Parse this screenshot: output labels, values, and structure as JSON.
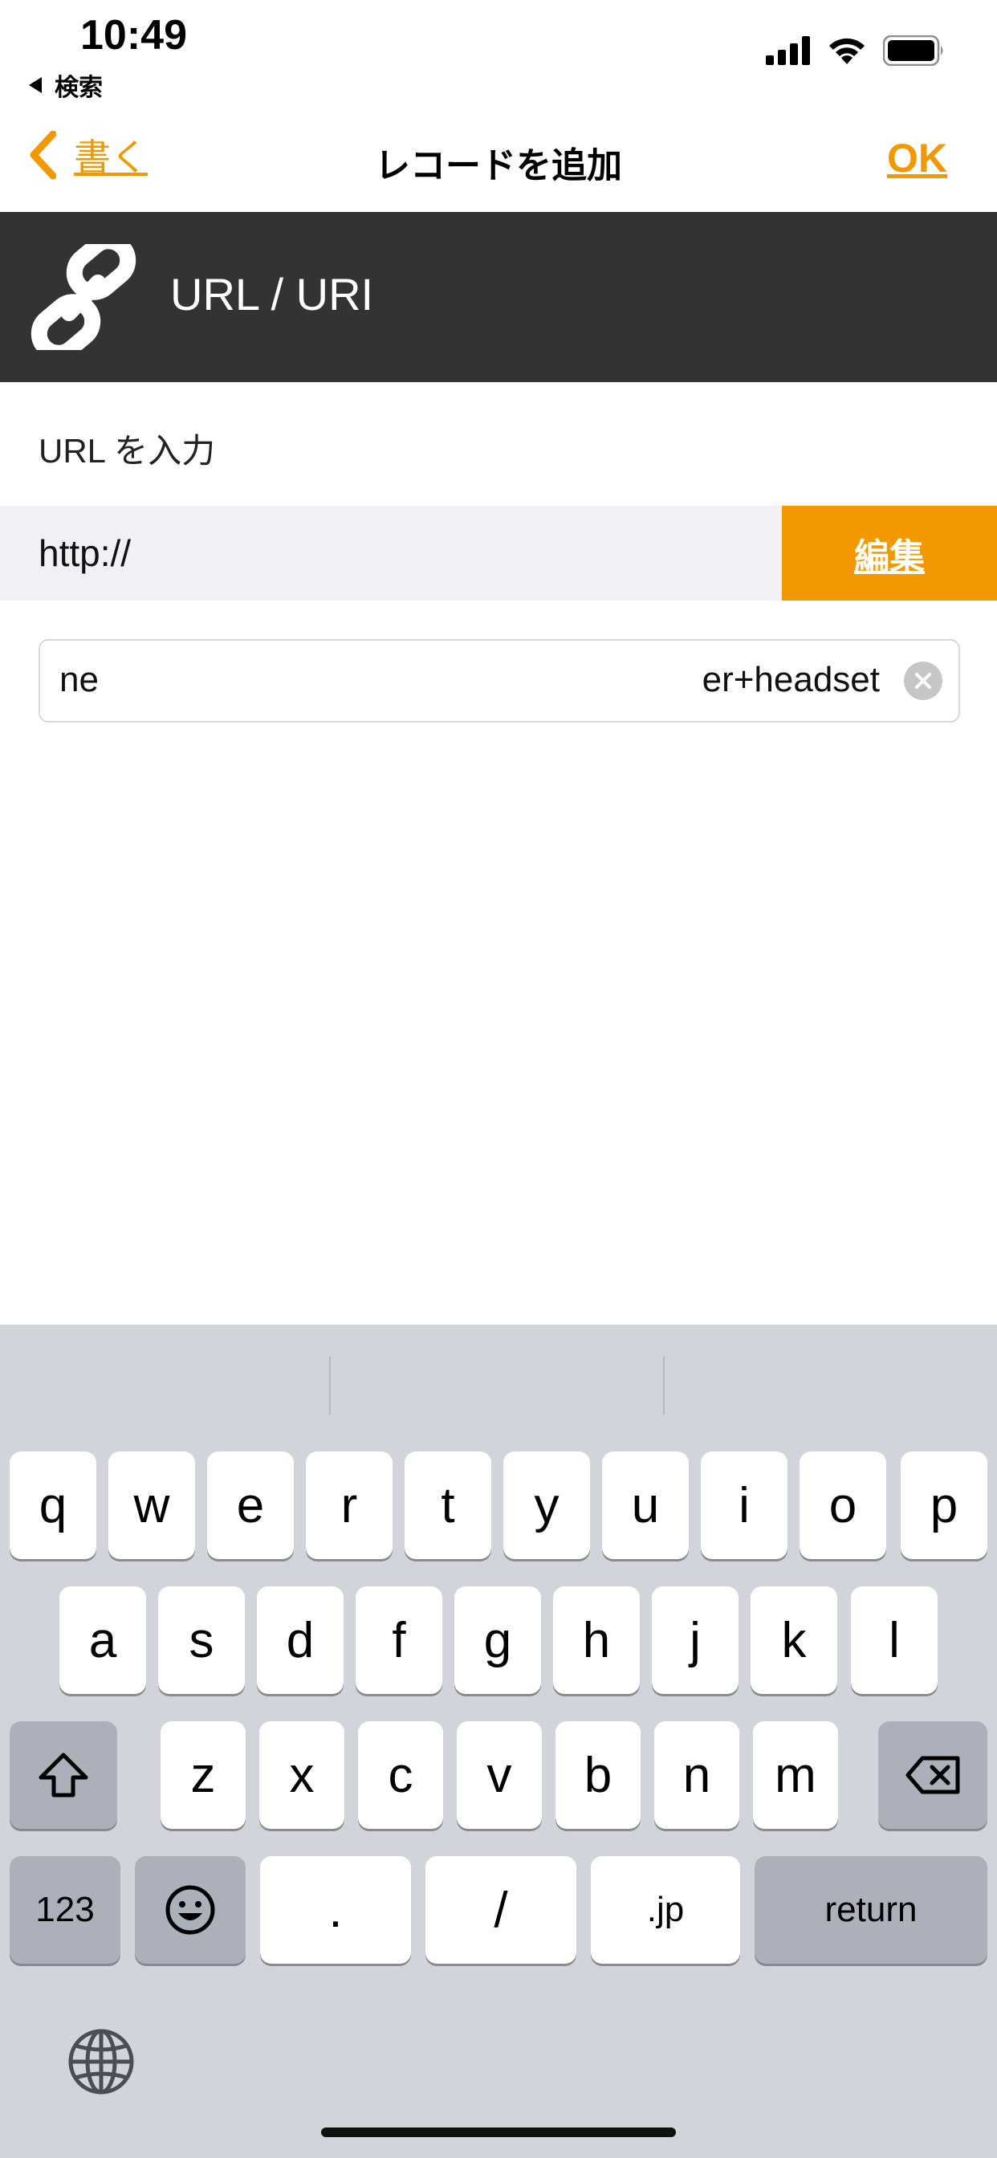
{
  "status_bar": {
    "time": "10:49",
    "back_app": "検索"
  },
  "nav": {
    "back_label": "書く",
    "title": "レコードを追加",
    "ok_label": "OK"
  },
  "section": {
    "title": "URL / URI",
    "icon": "link-icon"
  },
  "form": {
    "prompt": "URL を入力",
    "scheme": "http://",
    "edit_button": "編集",
    "url_value_start": "ne",
    "url_value_end": "er+headset"
  },
  "keyboard": {
    "row1": [
      "q",
      "w",
      "e",
      "r",
      "t",
      "y",
      "u",
      "i",
      "o",
      "p"
    ],
    "row2": [
      "a",
      "s",
      "d",
      "f",
      "g",
      "h",
      "j",
      "k",
      "l"
    ],
    "row3": [
      "z",
      "x",
      "c",
      "v",
      "b",
      "n",
      "m"
    ],
    "numbers_key": "123",
    "dot_key": ".",
    "slash_key": "/",
    "jp_key": ".jp",
    "return_key": "return"
  },
  "colors": {
    "accent": "#f39800",
    "header_bg": "#333333",
    "keyboard_bg": "#d1d4db"
  }
}
